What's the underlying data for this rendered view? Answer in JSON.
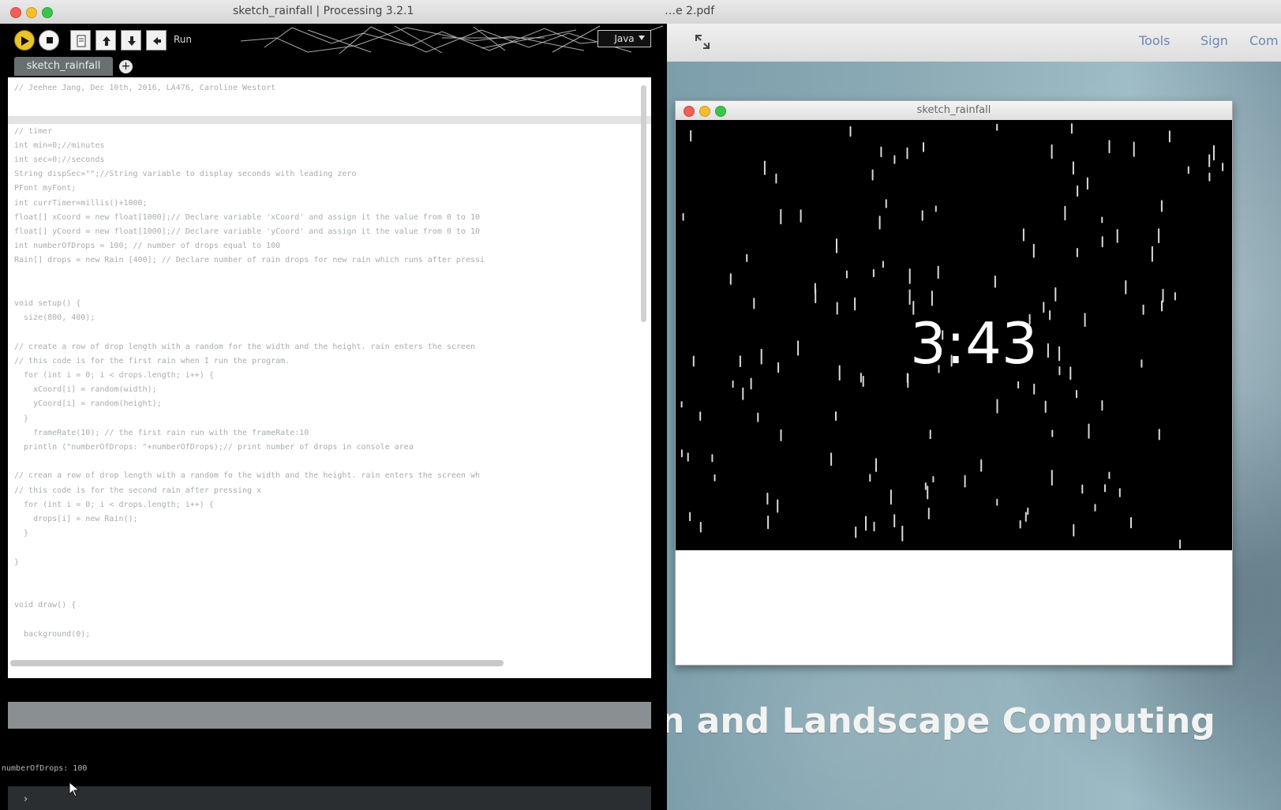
{
  "window": {
    "ide_title": "sketch_rainfall | Processing 3.2.1",
    "pdf_title": "…e 2.pdf",
    "traffic_light_colors": {
      "close": "#f15f56",
      "minimize": "#f6be2f",
      "maximize": "#3bc54c"
    }
  },
  "ide": {
    "toolbar": {
      "run_label": "Run",
      "mode_label": "Java",
      "icons": [
        "run-icon",
        "stop-icon",
        "new-sketch-icon",
        "open-icon",
        "save-icon",
        "export-icon"
      ]
    },
    "tab": {
      "name": "sketch_rainfall",
      "add_symbol": "+"
    },
    "editor_lines": [
      "// Jeehee Jang, Dec 10th, 2016, LA476, Caroline Westort",
      "",
      "",
      "// timer",
      "int min=0;//minutes",
      "int sec=0;//seconds",
      "String dispSec=\"\";//String variable to display seconds with leading zero",
      "PFont myFont;",
      "int currTimer=millis()+1000;",
      "float[] xCoord = new float[1000];// Declare variable 'xCoord' and assign it the value from 0 to 10",
      "float[] yCoord = new float[1000];// Declare variable 'yCoord' and assign it the value from 0 to 10",
      "int numberOfDrops = 100; // number of drops equal to 100",
      "Rain[] drops = new Rain [400]; // Declare number of rain drops for new rain which runs after pressi",
      "",
      "",
      "void setup() {",
      "  size(800, 400);",
      "",
      "// create a row of drop length with a random for the width and the height. rain enters the screen",
      "// this code is for the first rain when I run the program.",
      "  for (int i = 0; i < drops.length; i++) {",
      "    xCoord[i] = random(width);",
      "    yCoord[i] = random(height);",
      "  }",
      "    frameRate(10); // the first rain run with the frameRate:10",
      "  println (\"numberOfDrops: \"+numberOfDrops);// print number of drops in console area",
      "",
      "// crean a row of drop length with a random fo the width and the height. rain enters the screen wh",
      "// this code is for the second rain after pressing x",
      "  for (int i = 0; i < drops.length; i++) {",
      "    drops[i] = new Rain();",
      "  }",
      "",
      "}",
      "",
      "",
      "void draw() {",
      "",
      "  background(0);"
    ],
    "console_output": "numberOfDrops: 100",
    "bottom_prompt": "›"
  },
  "pdf": {
    "toolbar": {
      "tools_label": "Tools",
      "sign_label": "Sign",
      "comment_label": "Com"
    },
    "caption": "n and Landscape Computing"
  },
  "sketch_window": {
    "title": "sketch_rainfall",
    "timer": "3:43"
  }
}
